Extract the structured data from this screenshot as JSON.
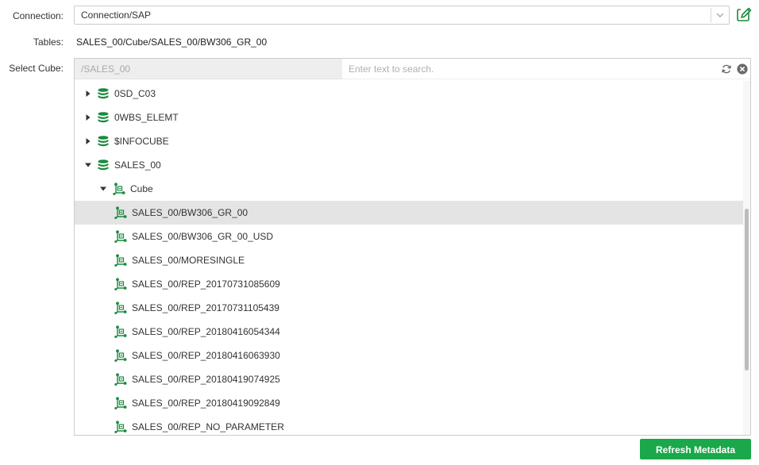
{
  "form": {
    "connection_label": "Connection:",
    "connection_value": "Connection/SAP",
    "tables_label": "Tables:",
    "tables_value": "SALES_00/Cube/SALES_00/BW306_GR_00",
    "select_cube_label": "Select Cube:"
  },
  "cube_selector": {
    "path": "/SALES_00",
    "search_placeholder": "Enter text to search."
  },
  "tree": {
    "nodes": [
      {
        "label": "0SD_C03",
        "type": "database",
        "level": 0,
        "expanded": false,
        "selected": false
      },
      {
        "label": "0WBS_ELEMT",
        "type": "database",
        "level": 0,
        "expanded": false,
        "selected": false
      },
      {
        "label": "$INFOCUBE",
        "type": "database",
        "level": 0,
        "expanded": false,
        "selected": false
      },
      {
        "label": "SALES_00",
        "type": "database",
        "level": 0,
        "expanded": true,
        "selected": false
      },
      {
        "label": "Cube",
        "type": "cube",
        "level": 1,
        "expanded": true,
        "selected": false
      },
      {
        "label": "SALES_00/BW306_GR_00",
        "type": "cube",
        "level": 2,
        "selected": true
      },
      {
        "label": "SALES_00/BW306_GR_00_USD",
        "type": "cube",
        "level": 2,
        "selected": false
      },
      {
        "label": "SALES_00/MORESINGLE",
        "type": "cube",
        "level": 2,
        "selected": false
      },
      {
        "label": "SALES_00/REP_20170731085609",
        "type": "cube",
        "level": 2,
        "selected": false
      },
      {
        "label": "SALES_00/REP_20170731105439",
        "type": "cube",
        "level": 2,
        "selected": false
      },
      {
        "label": "SALES_00/REP_20180416054344",
        "type": "cube",
        "level": 2,
        "selected": false
      },
      {
        "label": "SALES_00/REP_20180416063930",
        "type": "cube",
        "level": 2,
        "selected": false
      },
      {
        "label": "SALES_00/REP_20180419074925",
        "type": "cube",
        "level": 2,
        "selected": false
      },
      {
        "label": "SALES_00/REP_20180419092849",
        "type": "cube",
        "level": 2,
        "selected": false
      },
      {
        "label": "SALES_00/REP_NO_PARAMETER",
        "type": "cube",
        "level": 2,
        "selected": false
      }
    ]
  },
  "actions": {
    "refresh_metadata_label": "Refresh Metadata"
  },
  "colors": {
    "accent_green": "#1aa84a",
    "icon_green": "#1a8a3e",
    "selected_row": "#e4e4e4"
  },
  "icons": {
    "edit": "edit-icon",
    "dropdown": "chevron-down-icon",
    "refresh": "refresh-icon",
    "clear": "clear-icon",
    "database": "database-icon",
    "cube": "cube-icon",
    "expand": "caret-right-icon",
    "collapse": "caret-down-icon"
  }
}
